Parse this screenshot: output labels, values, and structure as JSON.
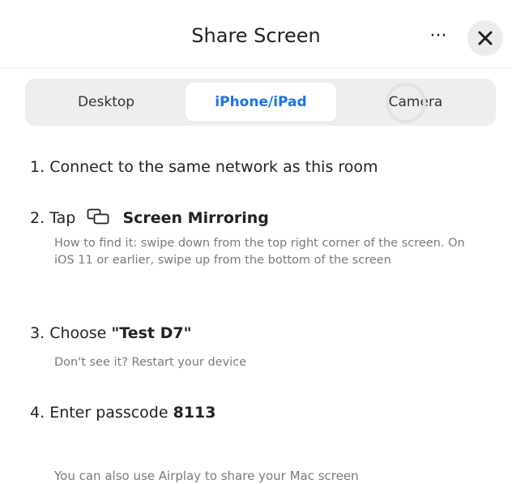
{
  "header": {
    "title": "Share Screen",
    "more_label": "···",
    "close_icon": "close-icon"
  },
  "tabs": [
    {
      "label": "Desktop",
      "active": false
    },
    {
      "label": "iPhone/iPad",
      "active": true
    },
    {
      "label": "Camera",
      "active": false
    }
  ],
  "colors": {
    "accent": "#1a73e8",
    "tab_bar_bg": "#eeeeee",
    "hint_text": "#7a7a7a"
  },
  "steps": [
    {
      "number": "1.",
      "text": "Connect to the same network as this room"
    },
    {
      "number": "2.",
      "prefix": "Tap",
      "icon": "screen-mirroring-icon",
      "bold": "Screen Mirroring",
      "hint": "How to find it: swipe down from the top right corner of the screen. On iOS 11 or earlier, swipe up from the bottom of the screen"
    },
    {
      "number": "3.",
      "prefix": "Choose",
      "bold": "\"Test D7\"",
      "hint": "Don't see it? Restart your device"
    },
    {
      "number": "4.",
      "prefix": "Enter passcode",
      "bold": "8113"
    }
  ],
  "footer_note": "You can also use Airplay to share your Mac screen"
}
